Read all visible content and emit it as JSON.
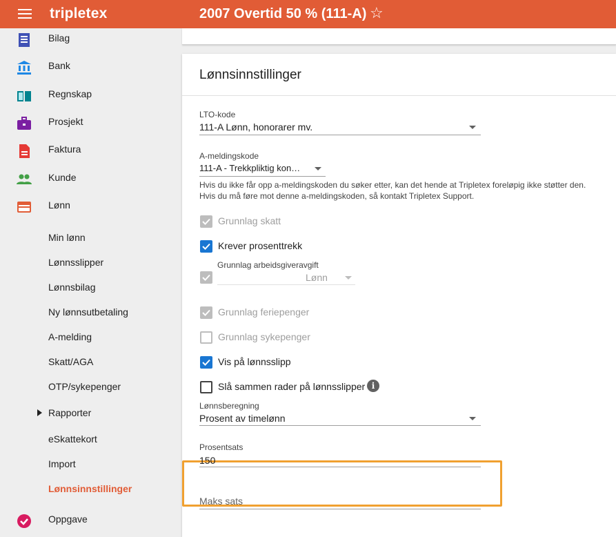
{
  "header": {
    "logo": "tripletex",
    "title": "2007 Overtid 50 % (111-A)",
    "star_icon": "☆"
  },
  "sidebar": {
    "items": [
      {
        "label": "Bilag",
        "icon": "document-icon",
        "color": "#3f51b5"
      },
      {
        "label": "Bank",
        "icon": "bank-icon",
        "color": "#1e88e5"
      },
      {
        "label": "Regnskap",
        "icon": "book-icon",
        "color": "#00838f"
      },
      {
        "label": "Prosjekt",
        "icon": "briefcase-icon",
        "color": "#7b1fa2"
      },
      {
        "label": "Faktura",
        "icon": "invoice-icon",
        "color": "#e53935"
      },
      {
        "label": "Kunde",
        "icon": "people-icon",
        "color": "#43a047"
      },
      {
        "label": "Lønn",
        "icon": "card-icon",
        "color": "#e15c36"
      }
    ],
    "sub_items": [
      {
        "label": "Min lønn"
      },
      {
        "label": "Lønnsslipper"
      },
      {
        "label": "Lønnsbilag"
      },
      {
        "label": "Ny lønnsutbetaling"
      },
      {
        "label": "A-melding"
      },
      {
        "label": "Skatt/AGA"
      },
      {
        "label": "OTP/sykepenger"
      },
      {
        "label": "Rapporter"
      },
      {
        "label": "eSkattekort"
      },
      {
        "label": "Import"
      },
      {
        "label": "Lønnsinnstillinger"
      }
    ],
    "bottom_item": {
      "label": "Oppgave",
      "icon": "check-circle-icon",
      "color": "#d81b60"
    }
  },
  "main": {
    "card_title": "Lønnsinnstillinger",
    "lto": {
      "label": "LTO-kode",
      "value": "111-A Lønn, honorarer mv."
    },
    "amelding": {
      "label": "A-meldingskode",
      "value": "111-A - Trekkpliktig kon…",
      "help_line1": "Hvis du ikke får opp a-meldingskoden du søker etter, kan det hende at Tripletex foreløpig ikke støtter den.",
      "help_line2": "Hvis du må føre mot denne a-meldingskoden, så kontakt Tripletex Support."
    },
    "checkboxes": {
      "grunnlag_skatt": "Grunnlag skatt",
      "krever_prosenttrekk": "Krever prosenttrekk",
      "arbeidsgiver_label": "Grunnlag arbeidsgiveravgift",
      "arbeidsgiver_value": "Lønn",
      "feriepenger": "Grunnlag feriepenger",
      "sykepenger": "Grunnlag sykepenger",
      "vis_lonnsslipp": "Vis på lønnsslipp",
      "sla_sammen": "Slå sammen rader på lønnsslipper"
    },
    "lonnsberegning": {
      "label": "Lønnsberegning",
      "value": "Prosent av timelønn"
    },
    "prosentsats": {
      "label": "Prosentsats",
      "value": "150"
    },
    "maks_sats": {
      "placeholder": "Maks sats"
    }
  }
}
